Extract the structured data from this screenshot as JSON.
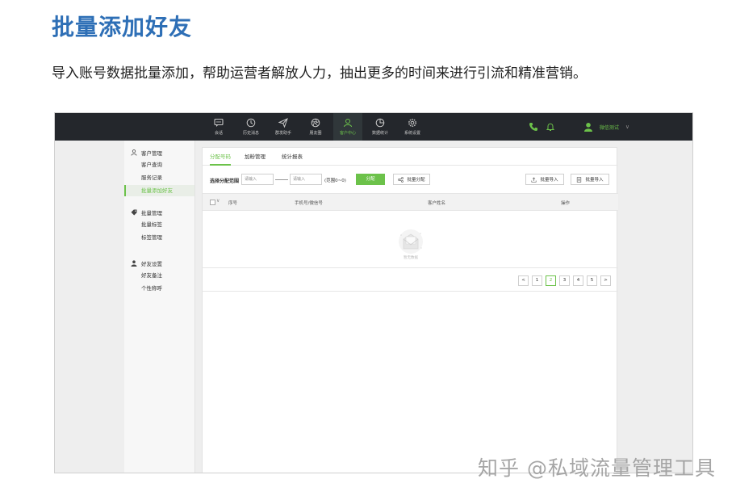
{
  "header": {
    "title": "批量添加好友",
    "subtitle": "导入账号数据批量添加，帮助运营者解放人力，抽出更多的时间来进行引流和精准营销。"
  },
  "topnav": {
    "items": [
      {
        "label": "会话",
        "icon": "chat-icon"
      },
      {
        "label": "历史消息",
        "icon": "clock-icon"
      },
      {
        "label": "群发助手",
        "icon": "send-icon"
      },
      {
        "label": "朋友圈",
        "icon": "aperture-icon"
      },
      {
        "label": "客户中心",
        "icon": "user-center-icon",
        "active": true
      },
      {
        "label": "数据统计",
        "icon": "pie-chart-icon"
      },
      {
        "label": "系统设置",
        "icon": "gear-icon"
      }
    ],
    "user_name": "微信测试",
    "user_chevron": "∨"
  },
  "sidebar": {
    "groups": [
      {
        "label": "客户管理",
        "icon": "user-tree-icon",
        "items": [
          "客户查询",
          "服务记录",
          "批量添加好友"
        ]
      },
      {
        "label": "批量管理",
        "icon": "tag-icon",
        "items": [
          "批量标签",
          "标签管理"
        ]
      },
      {
        "label": "好友设置",
        "icon": "user-icon",
        "items": [
          "好友备注",
          "个性称呼"
        ]
      }
    ],
    "active_item": "批量添加好友"
  },
  "main": {
    "tabs": [
      "分配号码",
      "加粉管理",
      "统计报表"
    ],
    "active_tab": "分配号码",
    "toolbar": {
      "range_label": "选择分配范围",
      "input_start_placeholder": "请输入",
      "input_end_placeholder": "请输入",
      "range_hint": "(范围0~0)",
      "assign_button": "分配",
      "batch_assign_button": "批量分配",
      "batch_import_button_1": "批量导入",
      "batch_import_button_2": "批量导入"
    },
    "table": {
      "columns": [
        "序号",
        "手机号/微信号",
        "客户姓名",
        "操作"
      ],
      "caret": "∨",
      "empty_text": "暂无数据"
    },
    "pagination": {
      "prev": "<",
      "pages": [
        "1",
        "2",
        "3",
        "4",
        "5"
      ],
      "current": "2",
      "next": ">"
    }
  },
  "watermark": "知乎 @私域流量管理工具",
  "colors": {
    "accent": "#6cc24a",
    "title_blue": "#2e6fb6",
    "topbar": "#24272c"
  }
}
